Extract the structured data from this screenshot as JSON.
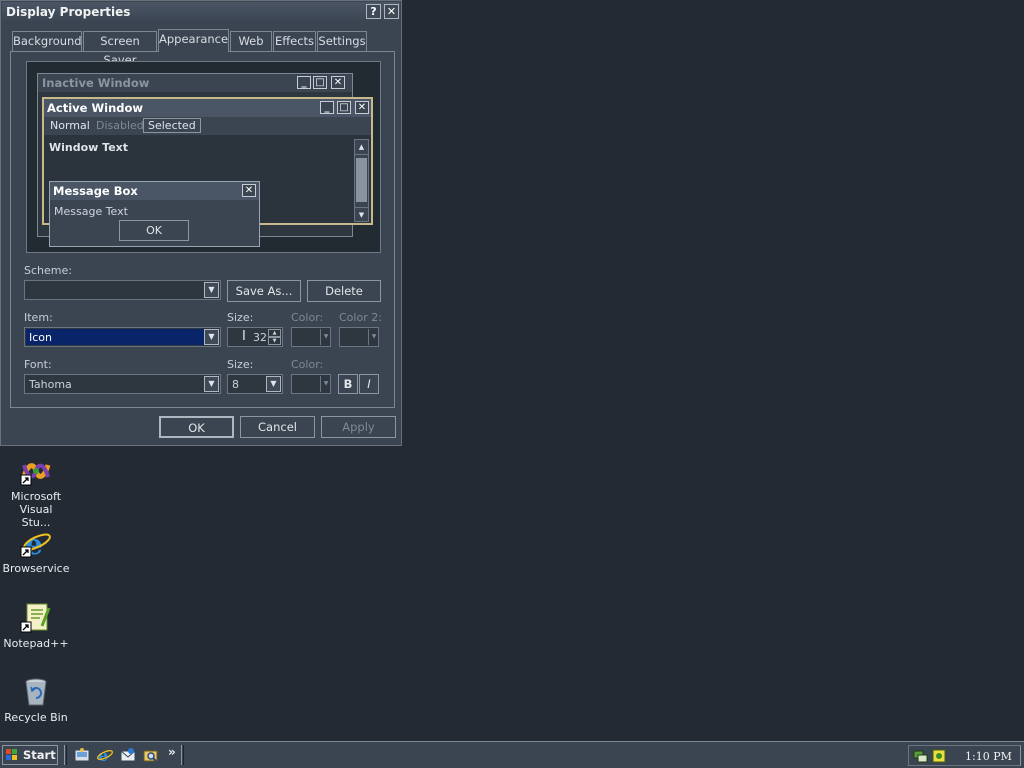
{
  "dialog": {
    "title": "Display Properties",
    "help_glyph": "?",
    "close_glyph": "✕",
    "tabs": [
      "Background",
      "Screen Saver",
      "Appearance",
      "Web",
      "Effects",
      "Settings"
    ],
    "active_tab": "Appearance",
    "preview": {
      "inactive_title": "Inactive Window",
      "active_title": "Active Window",
      "menu": [
        "Normal",
        "Disabled",
        "Selected"
      ],
      "window_text": "Window Text",
      "message_title": "Message Box",
      "message_text": "Message Text",
      "ok_label": "OK"
    },
    "scheme": {
      "label": "Scheme:",
      "value": "",
      "save_as": "Save As...",
      "delete": "Delete"
    },
    "item": {
      "label": "Item:",
      "value": "Icon",
      "size_label": "Size:",
      "size_value": "32",
      "color_label": "Color:",
      "color2_label": "Color 2:"
    },
    "font": {
      "label": "Font:",
      "value": "Tahoma",
      "size_label": "Size:",
      "size_value": "8",
      "color_label": "Color:",
      "bold": "B",
      "italic": "I"
    },
    "buttons": {
      "ok": "OK",
      "cancel": "Cancel",
      "apply": "Apply"
    }
  },
  "desktop": {
    "icons": [
      {
        "label": "Microsoft Visual Stu...",
        "icon": "visual-studio-icon"
      },
      {
        "label": "Browservice",
        "icon": "internet-explorer-icon"
      },
      {
        "label": "Notepad++",
        "icon": "notepad-plus-plus-icon"
      },
      {
        "label": "Recycle Bin",
        "icon": "recycle-bin-icon"
      }
    ]
  },
  "taskbar": {
    "start_label": "Start",
    "chevron": "»",
    "clock": "1:10 PM"
  },
  "colors": {
    "desktop": "#232a33",
    "selection": "#0a246a",
    "window": "#3b4551"
  }
}
